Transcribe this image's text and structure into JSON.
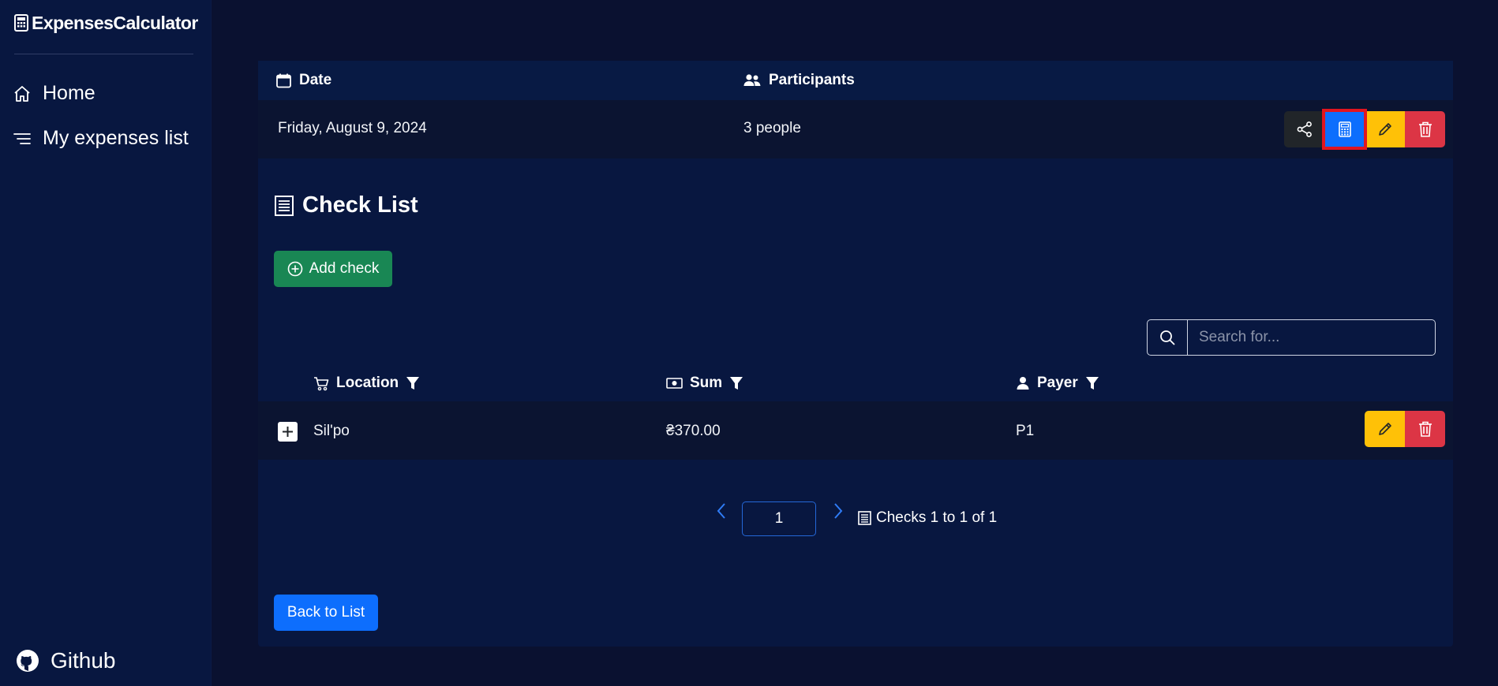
{
  "brand": {
    "title": "ExpensesCalculator"
  },
  "sidebar": {
    "items": [
      {
        "label": "Home",
        "icon": "home-icon"
      },
      {
        "label": "My expenses list",
        "icon": "list-icon"
      }
    ],
    "github_label": "Github"
  },
  "details": {
    "date_header": "Date",
    "participants_header": "Participants",
    "date_value": "Friday, August 9, 2024",
    "participants_value": "3 people",
    "actions": [
      "share-icon",
      "calculator-icon",
      "pencil-icon",
      "trash-icon"
    ]
  },
  "checklist": {
    "title": "Check List",
    "add_label": "Add check",
    "search_placeholder": "Search for...",
    "columns": {
      "location": "Location",
      "sum": "Sum",
      "payer": "Payer"
    },
    "rows": [
      {
        "location": "Sil'po",
        "sum": "₴370.00",
        "payer": "P1"
      }
    ]
  },
  "pager": {
    "page": "1",
    "summary": "Checks 1 to 1 of 1"
  },
  "back_label": "Back to List",
  "colors": {
    "background": "#0a1130",
    "panel": "#081740",
    "primary": "#0d6efd",
    "success": "#198754",
    "warning": "#ffc107",
    "danger": "#dc3545",
    "dark": "#212529",
    "highlight": "#e2151f"
  }
}
